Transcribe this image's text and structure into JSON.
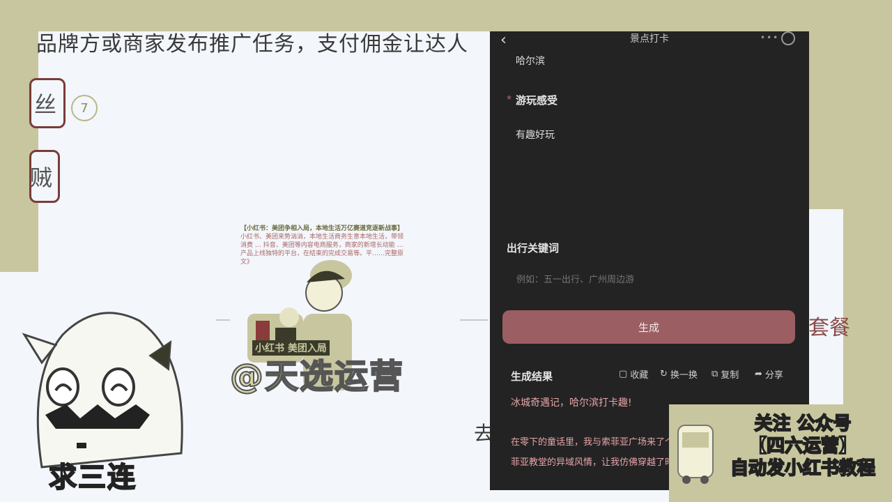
{
  "slide": {
    "top_text": "品牌方或商家发布推广任务，支付佣金让达人",
    "sub_text": "",
    "box1_text": "丝",
    "badge_number": "7",
    "box2_text": "贼",
    "tail_text": "去做的",
    "right_text": "套餐"
  },
  "poster": {
    "header": "【小红书：美团争相入局，本地生活万亿赛道竞逐新战事】",
    "body": "小红书、美团来势汹汹，本地生活商务生意本地生活，带领消费 … 抖音、美团等内容电商服务，商家的新增长动能 … 产品上线独特的平台，在结束的完成交易等。平……完整原文》",
    "caption": "小红书 美团入局",
    "watermark": "@天选运营"
  },
  "sticker": {
    "caption": "求三连"
  },
  "phone": {
    "title": "景点打卡",
    "menu": "•••",
    "city": "哈尔滨",
    "label_experience": "游玩感受",
    "experience_value": "有趣好玩",
    "label_keywords": "出行关键词",
    "keywords_placeholder": "例如：五一出行、广州周边游",
    "generate_button": "生成",
    "result_label": "生成结果",
    "actions": {
      "collect": "收藏",
      "refresh": "换一换",
      "copy": "复制",
      "share": "分享"
    },
    "result_title": "冰城奇遇记，哈尔滨打卡趣!",
    "result_body": "在零下的童话里，我与索菲亚广场来了个大大的拥抱。雪花飘落，圣·索菲亚教堂的异域风情，让我仿佛穿越了时空。嗯，"
  },
  "card": {
    "line1": "关注 公众号",
    "line2": "【四六运营】",
    "line3": "自动发小红书教程"
  },
  "colors": {
    "accent": "#9b5e63",
    "dark_panel": "#232323",
    "frame": "#c7c69e"
  }
}
